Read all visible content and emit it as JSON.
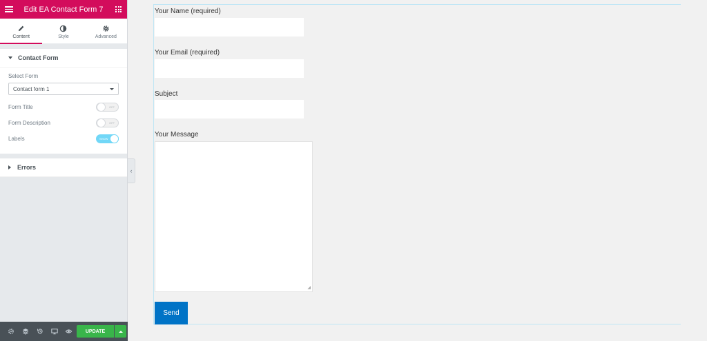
{
  "header": {
    "title": "Edit EA Contact Form 7"
  },
  "tabs": [
    {
      "label": "Content",
      "icon": "pencil-icon",
      "active": true
    },
    {
      "label": "Style",
      "icon": "half-circle-icon",
      "active": false
    },
    {
      "label": "Advanced",
      "icon": "gear-icon",
      "active": false
    }
  ],
  "contact_section": {
    "title": "Contact Form",
    "select_label": "Select Form",
    "select_value": "Contact form 1",
    "toggles": [
      {
        "label": "Form Title",
        "state": "OFF",
        "on": false
      },
      {
        "label": "Form Description",
        "state": "OFF",
        "on": false
      },
      {
        "label": "Labels",
        "state": "SHOW",
        "on": true
      }
    ]
  },
  "errors_section": {
    "title": "Errors"
  },
  "footer": {
    "update_label": "UPDATE"
  },
  "form": {
    "name_label": "Your Name (required)",
    "email_label": "Your Email (required)",
    "subject_label": "Subject",
    "message_label": "Your Message",
    "send_label": "Send"
  },
  "colors": {
    "brand": "#d30c5c",
    "update": "#39b54a",
    "send": "#0073c6",
    "toggle_on": "#71d7f7"
  }
}
